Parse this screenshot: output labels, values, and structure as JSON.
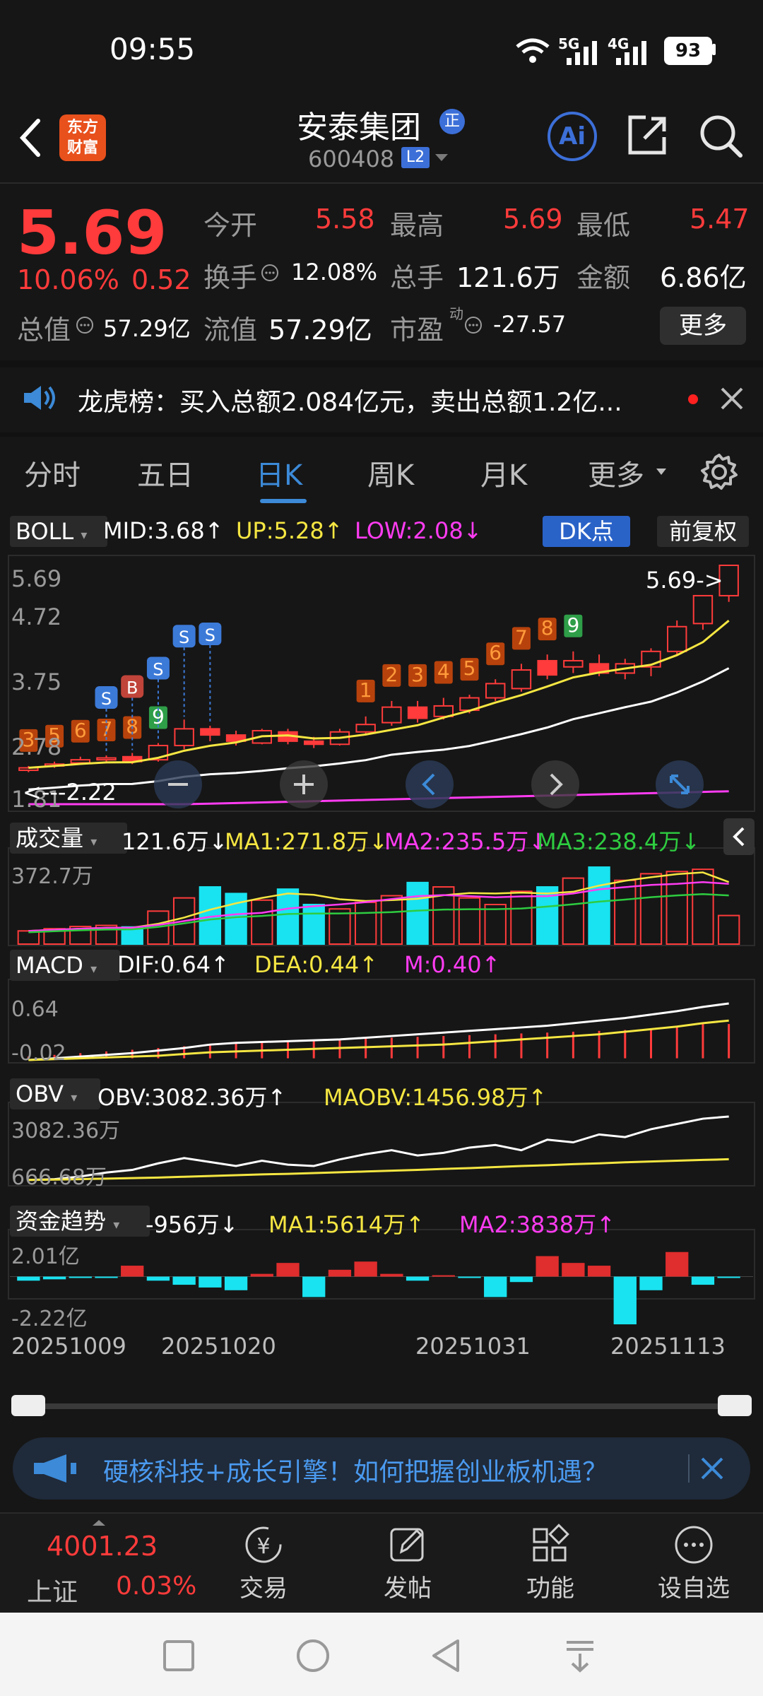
{
  "status": {
    "time": "09:55",
    "net1": "5G",
    "net2": "4G",
    "battery": "93"
  },
  "header": {
    "title": "安泰集团",
    "title_badge": "正",
    "code": "600408",
    "level": "L2",
    "brand_line1": "东方",
    "brand_line2": "财富",
    "ai_label": "Ai"
  },
  "quote": {
    "price": "5.69",
    "pct": "10.06%",
    "change": "0.52",
    "open_label": "今开",
    "open": "5.58",
    "high_label": "最高",
    "high": "5.69",
    "low_label": "最低",
    "low": "5.47",
    "turnover_label": "换手",
    "turnover": "12.08%",
    "vol_label": "总手",
    "vol": "121.6万",
    "amount_label": "金额",
    "amount": "6.86亿",
    "mcap_label": "总值",
    "mcap": "57.29亿",
    "float_label": "流值",
    "float": "57.29亿",
    "pe_label": "市盈",
    "pe_sup": "动",
    "pe": "-27.57",
    "more": "更多"
  },
  "news": {
    "text": "龙虎榜：买入总额2.084亿元，卖出总额1.2亿..."
  },
  "tabs": [
    "分时",
    "五日",
    "日K",
    "周K",
    "月K",
    "更多"
  ],
  "boll": {
    "label": "BOLL",
    "mid": "MID:3.68↑",
    "up": "UP:5.28↑",
    "low": "LOW:2.08↓",
    "dk": "DK点",
    "fuquan": "前复权"
  },
  "kline": {
    "y_labels": [
      "5.69",
      "4.72",
      "3.75",
      "2.78",
      "1.81"
    ],
    "last_label": "5.69->",
    "low_label": "<---2.22",
    "signal_digits": [
      "3",
      "5",
      "6",
      "7",
      "8",
      "9",
      "1",
      "2",
      "3",
      "4",
      "5",
      "6",
      "7",
      "8",
      "9"
    ],
    "sb_markers": [
      "S",
      "B",
      "S",
      "S",
      "S"
    ]
  },
  "volume": {
    "label": "成交量",
    "value": "121.6万↓",
    "ma1": "MA1:271.8万↓",
    "ma2": "MA2:235.5万↓",
    "ma3": "MA3:238.4万↓",
    "ymax": "372.7万"
  },
  "macd": {
    "label": "MACD",
    "dif": "DIF:0.64↑",
    "dea": "DEA:0.44↑",
    "m": "M:0.40↑",
    "ytop": "0.64",
    "ybot": "-0.02"
  },
  "obv": {
    "label": "OBV",
    "obv": "OBV:3082.36万↑",
    "maobv": "MAOBV:1456.98万↑",
    "ytop": "3082.36万",
    "ybot": "666.68万"
  },
  "fund": {
    "label": "资金趋势",
    "value": "-956万↓",
    "ma1": "MA1:5614万↑",
    "ma2": "MA2:3838万↑",
    "ytop": "2.01亿",
    "ybot": "-2.22亿"
  },
  "dates": [
    "20251009",
    "20251020",
    "20251031",
    "20251113"
  ],
  "ad": {
    "text": "硬核科技+成长引擎！如何把握创业板机遇？"
  },
  "bottom": {
    "index_value": "4001.23",
    "index_name": "上证",
    "index_pct": "0.03%",
    "trade": "交易",
    "post": "发帖",
    "func": "功能",
    "watch": "设自选"
  },
  "chart_data": {
    "type": "candlestick",
    "ylim": [
      1.81,
      5.69
    ],
    "candles": [
      {
        "o": 2.38,
        "c": 2.42,
        "h": 2.45,
        "l": 2.35
      },
      {
        "o": 2.45,
        "c": 2.48,
        "h": 2.52,
        "l": 2.42
      },
      {
        "o": 2.5,
        "c": 2.55,
        "h": 2.6,
        "l": 2.48
      },
      {
        "o": 2.55,
        "c": 2.58,
        "h": 2.62,
        "l": 2.5
      },
      {
        "o": 2.6,
        "c": 2.52,
        "h": 2.66,
        "l": 2.48
      },
      {
        "o": 2.55,
        "c": 2.78,
        "h": 2.82,
        "l": 2.52
      },
      {
        "o": 2.78,
        "c": 3.05,
        "h": 3.2,
        "l": 2.72
      },
      {
        "o": 3.05,
        "c": 2.95,
        "h": 3.1,
        "l": 2.85
      },
      {
        "o": 2.95,
        "c": 2.85,
        "h": 3.02,
        "l": 2.78
      },
      {
        "o": 2.82,
        "c": 3.02,
        "h": 3.05,
        "l": 2.8
      },
      {
        "o": 3.0,
        "c": 2.85,
        "h": 3.05,
        "l": 2.8
      },
      {
        "o": 2.85,
        "c": 2.8,
        "h": 2.92,
        "l": 2.74
      },
      {
        "o": 2.8,
        "c": 3.0,
        "h": 3.05,
        "l": 2.78
      },
      {
        "o": 3.0,
        "c": 3.12,
        "h": 3.25,
        "l": 2.95
      },
      {
        "o": 3.15,
        "c": 3.4,
        "h": 3.5,
        "l": 3.1
      },
      {
        "o": 3.4,
        "c": 3.22,
        "h": 3.5,
        "l": 3.15
      },
      {
        "o": 3.25,
        "c": 3.42,
        "h": 3.55,
        "l": 3.2
      },
      {
        "o": 3.35,
        "c": 3.55,
        "h": 3.6,
        "l": 3.3
      },
      {
        "o": 3.55,
        "c": 3.78,
        "h": 3.85,
        "l": 3.5
      },
      {
        "o": 3.7,
        "c": 4.0,
        "h": 4.1,
        "l": 3.65
      },
      {
        "o": 4.15,
        "c": 3.92,
        "h": 4.25,
        "l": 3.85
      },
      {
        "o": 4.05,
        "c": 4.15,
        "h": 4.3,
        "l": 3.95
      },
      {
        "o": 4.1,
        "c": 3.95,
        "h": 4.25,
        "l": 3.9
      },
      {
        "o": 3.95,
        "c": 4.1,
        "h": 4.18,
        "l": 3.85
      },
      {
        "o": 4.05,
        "c": 4.3,
        "h": 4.35,
        "l": 3.9
      },
      {
        "o": 4.3,
        "c": 4.7,
        "h": 4.8,
        "l": 4.25
      },
      {
        "o": 4.75,
        "c": 5.2,
        "h": 5.2,
        "l": 4.65
      },
      {
        "o": 5.2,
        "c": 5.69,
        "h": 5.69,
        "l": 5.1
      }
    ],
    "volume": [
      60,
      70,
      80,
      85,
      78,
      150,
      210,
      260,
      230,
      200,
      250,
      180,
      160,
      190,
      220,
      280,
      260,
      210,
      180,
      240,
      260,
      300,
      350,
      290,
      320,
      330,
      340,
      130
    ],
    "macd_hist": [
      0.02,
      0.04,
      0.06,
      0.08,
      0.1,
      0.12,
      0.14,
      0.16,
      0.17,
      0.18,
      0.19,
      0.2,
      0.22,
      0.23,
      0.24,
      0.25,
      0.26,
      0.27,
      0.28,
      0.29,
      0.3,
      0.31,
      0.32,
      0.33,
      0.35,
      0.37,
      0.4,
      0.4
    ],
    "dif": [
      -0.02,
      0.0,
      0.02,
      0.04,
      0.06,
      0.09,
      0.12,
      0.16,
      0.18,
      0.19,
      0.2,
      0.21,
      0.22,
      0.24,
      0.26,
      0.28,
      0.3,
      0.32,
      0.34,
      0.36,
      0.38,
      0.41,
      0.44,
      0.47,
      0.51,
      0.55,
      0.6,
      0.64
    ],
    "dea": [
      -0.02,
      -0.01,
      0.0,
      0.01,
      0.02,
      0.03,
      0.05,
      0.07,
      0.08,
      0.09,
      0.1,
      0.11,
      0.12,
      0.13,
      0.14,
      0.15,
      0.16,
      0.18,
      0.2,
      0.22,
      0.24,
      0.26,
      0.28,
      0.31,
      0.34,
      0.37,
      0.41,
      0.44
    ],
    "obv": [
      666.68,
      700,
      800,
      950,
      1050,
      1300,
      1500,
      1350,
      1200,
      1400,
      1250,
      1200,
      1450,
      1650,
      1800,
      1600,
      1700,
      1900,
      2000,
      1800,
      2200,
      2100,
      2400,
      2300,
      2600,
      2800,
      3000,
      3082.36
    ],
    "maobv": [
      666.68,
      680,
      700,
      720,
      740,
      760,
      790,
      820,
      850,
      880,
      900,
      930,
      960,
      990,
      1020,
      1050,
      1090,
      1120,
      1160,
      1200,
      1230,
      1270,
      1300,
      1340,
      1370,
      1400,
      1430,
      1456.98
    ],
    "fund": [
      -0.3,
      -0.2,
      -0.1,
      -0.1,
      0.8,
      -0.3,
      -0.6,
      -0.8,
      -1.0,
      0.2,
      1.0,
      -1.5,
      0.5,
      1.1,
      0.2,
      -0.3,
      0.1,
      -0.1,
      -1.5,
      -0.4,
      1.5,
      1.0,
      0.8,
      -3.5,
      -1.0,
      1.8,
      -0.6,
      -0.1
    ],
    "x_tick_labels": [
      "20251009",
      "20251020",
      "20251031",
      "20251113"
    ]
  }
}
